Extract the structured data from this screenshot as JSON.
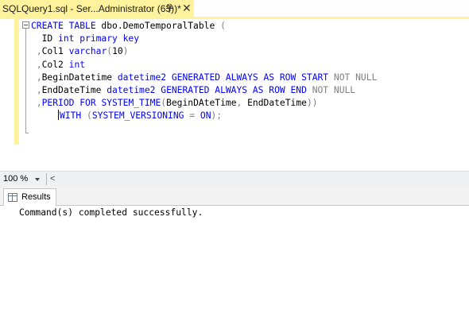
{
  "tab": {
    "title": "SQLQuery1.sql - Ser...Administrator (63))*",
    "close_glyph": "✕",
    "pin_icon": "pin-icon"
  },
  "editor": {
    "lines": [
      [
        {
          "t": "CREATE TABLE",
          "c": "k"
        },
        {
          "t": " dbo.DemoTemporalTable ",
          "c": ""
        },
        {
          "t": "(",
          "c": "g"
        }
      ],
      [
        {
          "t": "  ID ",
          "c": ""
        },
        {
          "t": "int primary key",
          "c": "k"
        }
      ],
      [
        {
          "t": " ",
          "c": ""
        },
        {
          "t": ",",
          "c": "g"
        },
        {
          "t": "Col1 ",
          "c": ""
        },
        {
          "t": "varchar",
          "c": "k"
        },
        {
          "t": "(",
          "c": "g"
        },
        {
          "t": "10",
          "c": ""
        },
        {
          "t": ")",
          "c": "g"
        }
      ],
      [
        {
          "t": " ",
          "c": ""
        },
        {
          "t": ",",
          "c": "g"
        },
        {
          "t": "Col2 ",
          "c": ""
        },
        {
          "t": "int",
          "c": "k"
        }
      ],
      [
        {
          "t": " ",
          "c": ""
        },
        {
          "t": ",",
          "c": "g"
        },
        {
          "t": "BeginDatetime ",
          "c": ""
        },
        {
          "t": "datetime2 GENERATED ALWAYS AS ROW START ",
          "c": "k"
        },
        {
          "t": "NOT NULL",
          "c": "g"
        }
      ],
      [
        {
          "t": " ",
          "c": ""
        },
        {
          "t": ",",
          "c": "g"
        },
        {
          "t": "EndDateTime ",
          "c": ""
        },
        {
          "t": "datetime2 GENERATED ALWAYS AS ROW END ",
          "c": "k"
        },
        {
          "t": "NOT NULL",
          "c": "g"
        }
      ],
      [
        {
          "t": " ",
          "c": ""
        },
        {
          "t": ",",
          "c": "g"
        },
        {
          "t": "PERIOD FOR SYSTEM_TIME",
          "c": "k"
        },
        {
          "t": "(",
          "c": "g"
        },
        {
          "t": "BeginDAteTime",
          "c": ""
        },
        {
          "t": ",",
          "c": "g"
        },
        {
          "t": " EndDateTime",
          "c": ""
        },
        {
          "t": "))",
          "c": "g"
        }
      ],
      [
        {
          "t": "     ",
          "c": ""
        },
        {
          "t": "|",
          "c": "caret"
        },
        {
          "t": "WITH ",
          "c": "k"
        },
        {
          "t": "(",
          "c": "g"
        },
        {
          "t": "SYSTEM_VERSIONING ",
          "c": "k"
        },
        {
          "t": "= ",
          "c": "g"
        },
        {
          "t": "ON",
          "c": "k"
        },
        {
          "t": ");",
          "c": "g"
        }
      ]
    ]
  },
  "status": {
    "zoom": "100 %",
    "scroll_left_glyph": "<"
  },
  "results": {
    "tab_label": "Results",
    "message": "Command(s) completed successfully."
  },
  "colors": {
    "tab_active": "#fff29d",
    "keyword": "#0000ff",
    "operator": "#808080"
  }
}
